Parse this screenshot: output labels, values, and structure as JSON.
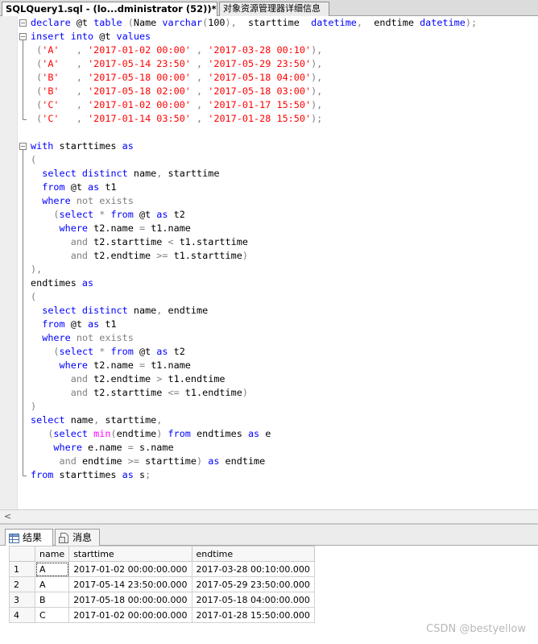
{
  "tabs": {
    "query_tab": "SQLQuery1.sql - (lo...dministrator (52))*",
    "explorer_tab": "对象资源管理器详细信息"
  },
  "editor": {
    "lines": [
      [
        [
          "kw",
          "declare "
        ],
        [
          "tx",
          "@t "
        ],
        [
          "kw",
          "table "
        ],
        [
          "gr",
          "("
        ],
        [
          "tx",
          "Name "
        ],
        [
          "kw",
          "varchar"
        ],
        [
          "gr",
          "("
        ],
        [
          "tx",
          "100"
        ],
        [
          "gr",
          "),"
        ],
        [
          "tx",
          "  starttime  "
        ],
        [
          "kw",
          "datetime"
        ],
        [
          "gr",
          ","
        ],
        [
          "tx",
          "  endtime "
        ],
        [
          "kw",
          "datetime"
        ],
        [
          "gr",
          ");"
        ]
      ],
      [
        [
          "kw",
          "insert into "
        ],
        [
          "tx",
          "@t "
        ],
        [
          "kw",
          "values"
        ]
      ],
      [
        [
          "tx",
          " "
        ],
        [
          "gr",
          "("
        ],
        [
          "st",
          "'A'"
        ],
        [
          "tx",
          "   "
        ],
        [
          "gr",
          ", "
        ],
        [
          "st",
          "'2017-01-02 00:00'"
        ],
        [
          "tx",
          " "
        ],
        [
          "gr",
          ", "
        ],
        [
          "st",
          "'2017-03-28 00:10'"
        ],
        [
          "gr",
          "),"
        ]
      ],
      [
        [
          "tx",
          " "
        ],
        [
          "gr",
          "("
        ],
        [
          "st",
          "'A'"
        ],
        [
          "tx",
          "   "
        ],
        [
          "gr",
          ", "
        ],
        [
          "st",
          "'2017-05-14 23:50'"
        ],
        [
          "tx",
          " "
        ],
        [
          "gr",
          ", "
        ],
        [
          "st",
          "'2017-05-29 23:50'"
        ],
        [
          "gr",
          "),"
        ]
      ],
      [
        [
          "tx",
          " "
        ],
        [
          "gr",
          "("
        ],
        [
          "st",
          "'B'"
        ],
        [
          "tx",
          "   "
        ],
        [
          "gr",
          ", "
        ],
        [
          "st",
          "'2017-05-18 00:00'"
        ],
        [
          "tx",
          " "
        ],
        [
          "gr",
          ", "
        ],
        [
          "st",
          "'2017-05-18 04:00'"
        ],
        [
          "gr",
          "),"
        ]
      ],
      [
        [
          "tx",
          " "
        ],
        [
          "gr",
          "("
        ],
        [
          "st",
          "'B'"
        ],
        [
          "tx",
          "   "
        ],
        [
          "gr",
          ", "
        ],
        [
          "st",
          "'2017-05-18 02:00'"
        ],
        [
          "tx",
          " "
        ],
        [
          "gr",
          ", "
        ],
        [
          "st",
          "'2017-05-18 03:00'"
        ],
        [
          "gr",
          "),"
        ]
      ],
      [
        [
          "tx",
          " "
        ],
        [
          "gr",
          "("
        ],
        [
          "st",
          "'C'"
        ],
        [
          "tx",
          "   "
        ],
        [
          "gr",
          ", "
        ],
        [
          "st",
          "'2017-01-02 00:00'"
        ],
        [
          "tx",
          " "
        ],
        [
          "gr",
          ", "
        ],
        [
          "st",
          "'2017-01-17 15:50'"
        ],
        [
          "gr",
          "),"
        ]
      ],
      [
        [
          "tx",
          " "
        ],
        [
          "gr",
          "("
        ],
        [
          "st",
          "'C'"
        ],
        [
          "tx",
          "   "
        ],
        [
          "gr",
          ", "
        ],
        [
          "st",
          "'2017-01-14 03:50'"
        ],
        [
          "tx",
          " "
        ],
        [
          "gr",
          ", "
        ],
        [
          "st",
          "'2017-01-28 15:50'"
        ],
        [
          "gr",
          ");"
        ]
      ],
      [],
      [
        [
          "kw",
          "with "
        ],
        [
          "tx",
          "starttimes "
        ],
        [
          "kw",
          "as"
        ]
      ],
      [
        [
          "gr",
          "("
        ]
      ],
      [
        [
          "tx",
          "  "
        ],
        [
          "kw",
          "select distinct "
        ],
        [
          "tx",
          "name"
        ],
        [
          "gr",
          ", "
        ],
        [
          "tx",
          "starttime"
        ]
      ],
      [
        [
          "tx",
          "  "
        ],
        [
          "kw",
          "from "
        ],
        [
          "tx",
          "@t "
        ],
        [
          "kw",
          "as "
        ],
        [
          "tx",
          "t1"
        ]
      ],
      [
        [
          "tx",
          "  "
        ],
        [
          "kw",
          "where "
        ],
        [
          "gr",
          "not exists"
        ]
      ],
      [
        [
          "tx",
          "    "
        ],
        [
          "gr",
          "("
        ],
        [
          "kw",
          "select "
        ],
        [
          "gr",
          "* "
        ],
        [
          "kw",
          "from "
        ],
        [
          "tx",
          "@t "
        ],
        [
          "kw",
          "as "
        ],
        [
          "tx",
          "t2"
        ]
      ],
      [
        [
          "tx",
          "     "
        ],
        [
          "kw",
          "where "
        ],
        [
          "tx",
          "t2.name "
        ],
        [
          "gr",
          "= "
        ],
        [
          "tx",
          "t1.name"
        ]
      ],
      [
        [
          "tx",
          "       "
        ],
        [
          "gr",
          "and "
        ],
        [
          "tx",
          "t2.starttime "
        ],
        [
          "gr",
          "< "
        ],
        [
          "tx",
          "t1.starttime"
        ]
      ],
      [
        [
          "tx",
          "       "
        ],
        [
          "gr",
          "and "
        ],
        [
          "tx",
          "t2.endtime "
        ],
        [
          "gr",
          ">= "
        ],
        [
          "tx",
          "t1.starttime"
        ],
        [
          "gr",
          ")"
        ]
      ],
      [
        [
          "gr",
          "),"
        ]
      ],
      [
        [
          "tx",
          "endtimes "
        ],
        [
          "kw",
          "as"
        ]
      ],
      [
        [
          "gr",
          "("
        ]
      ],
      [
        [
          "tx",
          "  "
        ],
        [
          "kw",
          "select distinct "
        ],
        [
          "tx",
          "name"
        ],
        [
          "gr",
          ", "
        ],
        [
          "tx",
          "endtime"
        ]
      ],
      [
        [
          "tx",
          "  "
        ],
        [
          "kw",
          "from "
        ],
        [
          "tx",
          "@t "
        ],
        [
          "kw",
          "as "
        ],
        [
          "tx",
          "t1"
        ]
      ],
      [
        [
          "tx",
          "  "
        ],
        [
          "kw",
          "where "
        ],
        [
          "gr",
          "not exists"
        ]
      ],
      [
        [
          "tx",
          "    "
        ],
        [
          "gr",
          "("
        ],
        [
          "kw",
          "select "
        ],
        [
          "gr",
          "* "
        ],
        [
          "kw",
          "from "
        ],
        [
          "tx",
          "@t "
        ],
        [
          "kw",
          "as "
        ],
        [
          "tx",
          "t2"
        ]
      ],
      [
        [
          "tx",
          "     "
        ],
        [
          "kw",
          "where "
        ],
        [
          "tx",
          "t2.name "
        ],
        [
          "gr",
          "= "
        ],
        [
          "tx",
          "t1.name"
        ]
      ],
      [
        [
          "tx",
          "       "
        ],
        [
          "gr",
          "and "
        ],
        [
          "tx",
          "t2.endtime "
        ],
        [
          "gr",
          "> "
        ],
        [
          "tx",
          "t1.endtime"
        ]
      ],
      [
        [
          "tx",
          "       "
        ],
        [
          "gr",
          "and "
        ],
        [
          "tx",
          "t2.starttime "
        ],
        [
          "gr",
          "<= "
        ],
        [
          "tx",
          "t1.endtime"
        ],
        [
          "gr",
          ")"
        ]
      ],
      [
        [
          "gr",
          ")"
        ]
      ],
      [
        [
          "kw",
          "select "
        ],
        [
          "tx",
          "name"
        ],
        [
          "gr",
          ", "
        ],
        [
          "tx",
          "starttime"
        ],
        [
          "gr",
          ","
        ]
      ],
      [
        [
          "tx",
          "   "
        ],
        [
          "gr",
          "("
        ],
        [
          "kw",
          "select "
        ],
        [
          "fn",
          "min"
        ],
        [
          "gr",
          "("
        ],
        [
          "tx",
          "endtime"
        ],
        [
          "gr",
          ") "
        ],
        [
          "kw",
          "from "
        ],
        [
          "tx",
          "endtimes "
        ],
        [
          "kw",
          "as "
        ],
        [
          "tx",
          "e"
        ]
      ],
      [
        [
          "tx",
          "    "
        ],
        [
          "kw",
          "where "
        ],
        [
          "tx",
          "e.name "
        ],
        [
          "gr",
          "= "
        ],
        [
          "tx",
          "s.name"
        ]
      ],
      [
        [
          "tx",
          "     "
        ],
        [
          "gr",
          "and "
        ],
        [
          "tx",
          "endtime "
        ],
        [
          "gr",
          ">= "
        ],
        [
          "tx",
          "starttime"
        ],
        [
          "gr",
          ") "
        ],
        [
          "kw",
          "as "
        ],
        [
          "tx",
          "endtime"
        ]
      ],
      [
        [
          "kw",
          "from "
        ],
        [
          "tx",
          "starttimes "
        ],
        [
          "kw",
          "as "
        ],
        [
          "tx",
          "s"
        ],
        [
          "gr",
          ";"
        ]
      ]
    ]
  },
  "scrollbar": {
    "left_arrow": "<"
  },
  "results_tabs": {
    "results_label": "结果",
    "messages_label": "消息"
  },
  "grid": {
    "columns": [
      "name",
      "starttime",
      "endtime"
    ],
    "rows": [
      {
        "num": "1",
        "name": "A",
        "starttime": "2017-01-02 00:00:00.000",
        "endtime": "2017-03-28 00:10:00.000"
      },
      {
        "num": "2",
        "name": "A",
        "starttime": "2017-05-14 23:50:00.000",
        "endtime": "2017-05-29 23:50:00.000"
      },
      {
        "num": "3",
        "name": "B",
        "starttime": "2017-05-18 00:00:00.000",
        "endtime": "2017-05-18 04:00:00.000"
      },
      {
        "num": "4",
        "name": "C",
        "starttime": "2017-01-02 00:00:00.000",
        "endtime": "2017-01-28 15:50:00.000"
      }
    ]
  },
  "watermark": "CSDN @bestyellow",
  "colors": {
    "keyword": "#0000ff",
    "operator": "#808080",
    "string": "#ff0000",
    "function": "#ff00ff"
  }
}
